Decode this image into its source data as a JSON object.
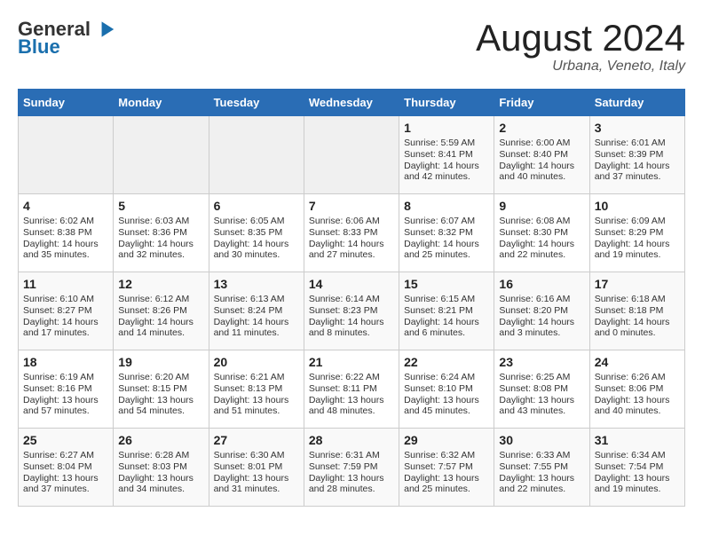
{
  "header": {
    "logo_general": "General",
    "logo_blue": "Blue",
    "month_year": "August 2024",
    "location": "Urbana, Veneto, Italy"
  },
  "days_of_week": [
    "Sunday",
    "Monday",
    "Tuesday",
    "Wednesday",
    "Thursday",
    "Friday",
    "Saturday"
  ],
  "weeks": [
    [
      {
        "day": "",
        "empty": true
      },
      {
        "day": "",
        "empty": true
      },
      {
        "day": "",
        "empty": true
      },
      {
        "day": "",
        "empty": true
      },
      {
        "day": "1",
        "sunrise": "Sunrise: 5:59 AM",
        "sunset": "Sunset: 8:41 PM",
        "daylight": "Daylight: 14 hours and 42 minutes."
      },
      {
        "day": "2",
        "sunrise": "Sunrise: 6:00 AM",
        "sunset": "Sunset: 8:40 PM",
        "daylight": "Daylight: 14 hours and 40 minutes."
      },
      {
        "day": "3",
        "sunrise": "Sunrise: 6:01 AM",
        "sunset": "Sunset: 8:39 PM",
        "daylight": "Daylight: 14 hours and 37 minutes."
      }
    ],
    [
      {
        "day": "4",
        "sunrise": "Sunrise: 6:02 AM",
        "sunset": "Sunset: 8:38 PM",
        "daylight": "Daylight: 14 hours and 35 minutes."
      },
      {
        "day": "5",
        "sunrise": "Sunrise: 6:03 AM",
        "sunset": "Sunset: 8:36 PM",
        "daylight": "Daylight: 14 hours and 32 minutes."
      },
      {
        "day": "6",
        "sunrise": "Sunrise: 6:05 AM",
        "sunset": "Sunset: 8:35 PM",
        "daylight": "Daylight: 14 hours and 30 minutes."
      },
      {
        "day": "7",
        "sunrise": "Sunrise: 6:06 AM",
        "sunset": "Sunset: 8:33 PM",
        "daylight": "Daylight: 14 hours and 27 minutes."
      },
      {
        "day": "8",
        "sunrise": "Sunrise: 6:07 AM",
        "sunset": "Sunset: 8:32 PM",
        "daylight": "Daylight: 14 hours and 25 minutes."
      },
      {
        "day": "9",
        "sunrise": "Sunrise: 6:08 AM",
        "sunset": "Sunset: 8:30 PM",
        "daylight": "Daylight: 14 hours and 22 minutes."
      },
      {
        "day": "10",
        "sunrise": "Sunrise: 6:09 AM",
        "sunset": "Sunset: 8:29 PM",
        "daylight": "Daylight: 14 hours and 19 minutes."
      }
    ],
    [
      {
        "day": "11",
        "sunrise": "Sunrise: 6:10 AM",
        "sunset": "Sunset: 8:27 PM",
        "daylight": "Daylight: 14 hours and 17 minutes."
      },
      {
        "day": "12",
        "sunrise": "Sunrise: 6:12 AM",
        "sunset": "Sunset: 8:26 PM",
        "daylight": "Daylight: 14 hours and 14 minutes."
      },
      {
        "day": "13",
        "sunrise": "Sunrise: 6:13 AM",
        "sunset": "Sunset: 8:24 PM",
        "daylight": "Daylight: 14 hours and 11 minutes."
      },
      {
        "day": "14",
        "sunrise": "Sunrise: 6:14 AM",
        "sunset": "Sunset: 8:23 PM",
        "daylight": "Daylight: 14 hours and 8 minutes."
      },
      {
        "day": "15",
        "sunrise": "Sunrise: 6:15 AM",
        "sunset": "Sunset: 8:21 PM",
        "daylight": "Daylight: 14 hours and 6 minutes."
      },
      {
        "day": "16",
        "sunrise": "Sunrise: 6:16 AM",
        "sunset": "Sunset: 8:20 PM",
        "daylight": "Daylight: 14 hours and 3 minutes."
      },
      {
        "day": "17",
        "sunrise": "Sunrise: 6:18 AM",
        "sunset": "Sunset: 8:18 PM",
        "daylight": "Daylight: 14 hours and 0 minutes."
      }
    ],
    [
      {
        "day": "18",
        "sunrise": "Sunrise: 6:19 AM",
        "sunset": "Sunset: 8:16 PM",
        "daylight": "Daylight: 13 hours and 57 minutes."
      },
      {
        "day": "19",
        "sunrise": "Sunrise: 6:20 AM",
        "sunset": "Sunset: 8:15 PM",
        "daylight": "Daylight: 13 hours and 54 minutes."
      },
      {
        "day": "20",
        "sunrise": "Sunrise: 6:21 AM",
        "sunset": "Sunset: 8:13 PM",
        "daylight": "Daylight: 13 hours and 51 minutes."
      },
      {
        "day": "21",
        "sunrise": "Sunrise: 6:22 AM",
        "sunset": "Sunset: 8:11 PM",
        "daylight": "Daylight: 13 hours and 48 minutes."
      },
      {
        "day": "22",
        "sunrise": "Sunrise: 6:24 AM",
        "sunset": "Sunset: 8:10 PM",
        "daylight": "Daylight: 13 hours and 45 minutes."
      },
      {
        "day": "23",
        "sunrise": "Sunrise: 6:25 AM",
        "sunset": "Sunset: 8:08 PM",
        "daylight": "Daylight: 13 hours and 43 minutes."
      },
      {
        "day": "24",
        "sunrise": "Sunrise: 6:26 AM",
        "sunset": "Sunset: 8:06 PM",
        "daylight": "Daylight: 13 hours and 40 minutes."
      }
    ],
    [
      {
        "day": "25",
        "sunrise": "Sunrise: 6:27 AM",
        "sunset": "Sunset: 8:04 PM",
        "daylight": "Daylight: 13 hours and 37 minutes."
      },
      {
        "day": "26",
        "sunrise": "Sunrise: 6:28 AM",
        "sunset": "Sunset: 8:03 PM",
        "daylight": "Daylight: 13 hours and 34 minutes."
      },
      {
        "day": "27",
        "sunrise": "Sunrise: 6:30 AM",
        "sunset": "Sunset: 8:01 PM",
        "daylight": "Daylight: 13 hours and 31 minutes."
      },
      {
        "day": "28",
        "sunrise": "Sunrise: 6:31 AM",
        "sunset": "Sunset: 7:59 PM",
        "daylight": "Daylight: 13 hours and 28 minutes."
      },
      {
        "day": "29",
        "sunrise": "Sunrise: 6:32 AM",
        "sunset": "Sunset: 7:57 PM",
        "daylight": "Daylight: 13 hours and 25 minutes."
      },
      {
        "day": "30",
        "sunrise": "Sunrise: 6:33 AM",
        "sunset": "Sunset: 7:55 PM",
        "daylight": "Daylight: 13 hours and 22 minutes."
      },
      {
        "day": "31",
        "sunrise": "Sunrise: 6:34 AM",
        "sunset": "Sunset: 7:54 PM",
        "daylight": "Daylight: 13 hours and 19 minutes."
      }
    ]
  ]
}
